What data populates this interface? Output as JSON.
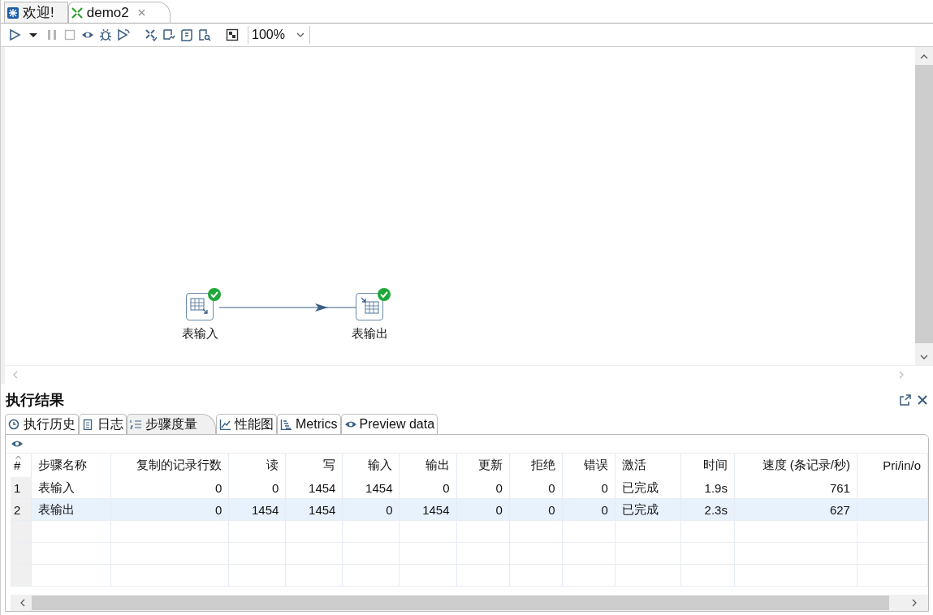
{
  "editor_tabs": [
    {
      "label": "欢迎!",
      "kind": "welcome",
      "selected": false,
      "closable": false
    },
    {
      "label": "demo2",
      "kind": "transform",
      "selected": true,
      "closable": true
    }
  ],
  "toolbar": {
    "buttons": [
      {
        "kind": "run",
        "disabled": false
      },
      {
        "kind": "dropdown",
        "disabled": false
      },
      {
        "kind": "pause",
        "disabled": true
      },
      {
        "kind": "stop",
        "disabled": true
      },
      {
        "kind": "preview",
        "disabled": false
      },
      {
        "kind": "debug",
        "disabled": false
      },
      {
        "kind": "replay",
        "disabled": false
      },
      {
        "kind": "verify",
        "disabled": false
      },
      {
        "kind": "impact",
        "disabled": false
      },
      {
        "kind": "sql",
        "disabled": false
      },
      {
        "kind": "explore",
        "disabled": false
      },
      {
        "kind": "grid",
        "disabled": false
      }
    ],
    "zoom": "100%"
  },
  "canvas": {
    "steps": [
      {
        "label": "表输入",
        "kind": "input",
        "finished": true
      },
      {
        "label": "表输出",
        "kind": "output",
        "finished": true
      }
    ]
  },
  "results": {
    "title": "执行结果",
    "tabs": [
      {
        "label": "执行历史",
        "kind": "history",
        "selected": false
      },
      {
        "label": "日志",
        "kind": "log",
        "selected": false
      },
      {
        "label": "步骤度量",
        "kind": "metrics-list",
        "selected": true
      },
      {
        "label": "性能图",
        "kind": "chart",
        "selected": false
      },
      {
        "label": "Metrics",
        "kind": "gantt",
        "selected": false
      },
      {
        "label": "Preview data",
        "kind": "preview",
        "selected": false
      }
    ],
    "table": {
      "columns": [
        "#",
        "步骤名称",
        "复制的记录行数",
        "读",
        "写",
        "输入",
        "输出",
        "更新",
        "拒绝",
        "错误",
        "激活",
        "时间",
        "速度 (条记录/秒)",
        "Pri/in/o"
      ],
      "rows": [
        {
          "selected": false,
          "cells": [
            "1",
            "表输入",
            "0",
            "0",
            "1454",
            "1454",
            "0",
            "0",
            "0",
            "0",
            "已完成",
            "1.9s",
            "761",
            ""
          ]
        },
        {
          "selected": true,
          "cells": [
            "2",
            "表输出",
            "0",
            "1454",
            "1454",
            "0",
            "1454",
            "0",
            "0",
            "0",
            "已完成",
            "2.3s",
            "627",
            ""
          ]
        }
      ]
    }
  }
}
